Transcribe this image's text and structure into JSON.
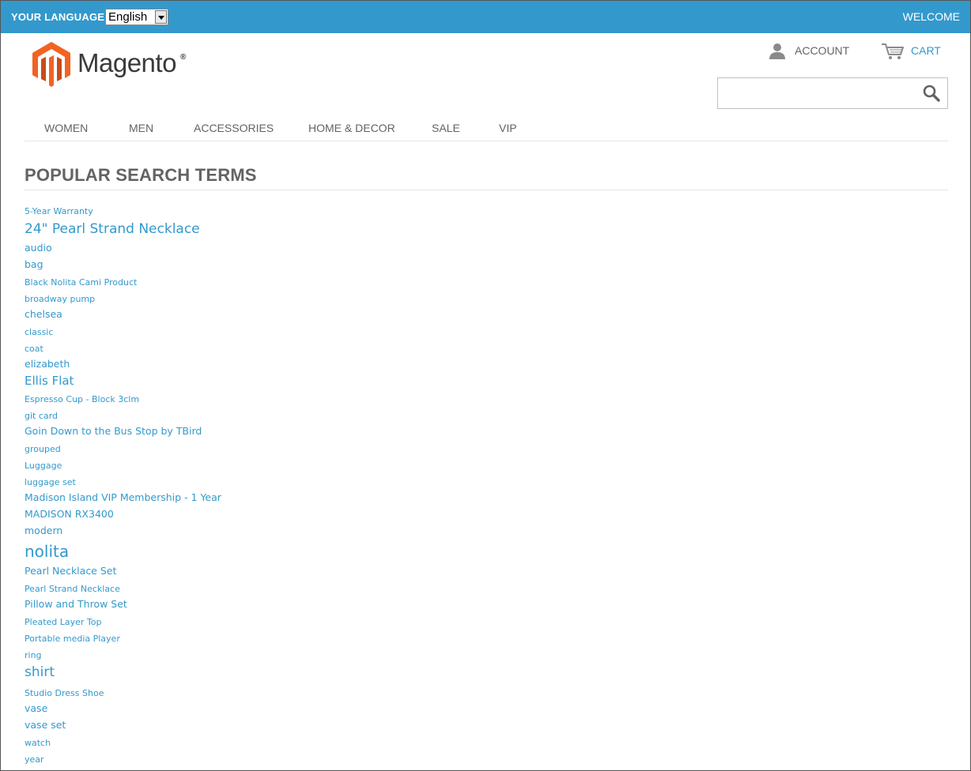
{
  "topbar": {
    "language_label": "YOUR LANGUAGE:",
    "language_selected": "English",
    "welcome": "WELCOME"
  },
  "logo": {
    "text": "Magento",
    "mark": "®"
  },
  "header": {
    "account_label": "ACCOUNT",
    "cart_label": "CART",
    "search_placeholder": ""
  },
  "nav": {
    "items": [
      "WOMEN",
      "MEN",
      "ACCESSORIES",
      "HOME & DECOR",
      "SALE",
      "VIP"
    ]
  },
  "page": {
    "title": "POPULAR SEARCH TERMS"
  },
  "terms": [
    {
      "label": "5-Year Warranty",
      "size": 1
    },
    {
      "label": "24\" Pearl Strand Necklace",
      "size": 4
    },
    {
      "label": "audio",
      "size": 2
    },
    {
      "label": "bag",
      "size": 2
    },
    {
      "label": "Black Nolita Cami Product",
      "size": 1
    },
    {
      "label": "broadway pump",
      "size": 1
    },
    {
      "label": "chelsea",
      "size": 2
    },
    {
      "label": "classic",
      "size": 1
    },
    {
      "label": "coat",
      "size": 1
    },
    {
      "label": "elizabeth",
      "size": 2
    },
    {
      "label": "Ellis Flat",
      "size": 3
    },
    {
      "label": "Espresso Cup - Block 3clm",
      "size": 1
    },
    {
      "label": "git card",
      "size": 1
    },
    {
      "label": "Goin Down to the Bus Stop by TBird",
      "size": 2
    },
    {
      "label": "grouped",
      "size": 1
    },
    {
      "label": "Luggage",
      "size": 1
    },
    {
      "label": "luggage set",
      "size": 1
    },
    {
      "label": "Madison Island VIP Membership - 1 Year",
      "size": 2
    },
    {
      "label": "MADISON RX3400",
      "size": 2
    },
    {
      "label": "modern",
      "size": 2
    },
    {
      "label": "nolita",
      "size": 5
    },
    {
      "label": "Pearl Necklace Set",
      "size": 2
    },
    {
      "label": "Pearl Strand Necklace",
      "size": 1
    },
    {
      "label": "Pillow and Throw Set",
      "size": 2
    },
    {
      "label": "Pleated Layer Top",
      "size": 1
    },
    {
      "label": "Portable media Player",
      "size": 1
    },
    {
      "label": "ring",
      "size": 1
    },
    {
      "label": "shirt",
      "size": 4
    },
    {
      "label": "Studio Dress Shoe",
      "size": 1
    },
    {
      "label": "vase",
      "size": 2
    },
    {
      "label": "vase set",
      "size": 2
    },
    {
      "label": "watch",
      "size": 1
    },
    {
      "label": "year",
      "size": 1
    }
  ],
  "colors": {
    "brand_blue": "#3399cc",
    "logo_orange": "#f26322",
    "text_gray": "#636363"
  },
  "icons": [
    "logo-hexagon-icon",
    "account-person-icon",
    "cart-icon",
    "search-magnifier-icon",
    "dropdown-arrow-icon"
  ]
}
